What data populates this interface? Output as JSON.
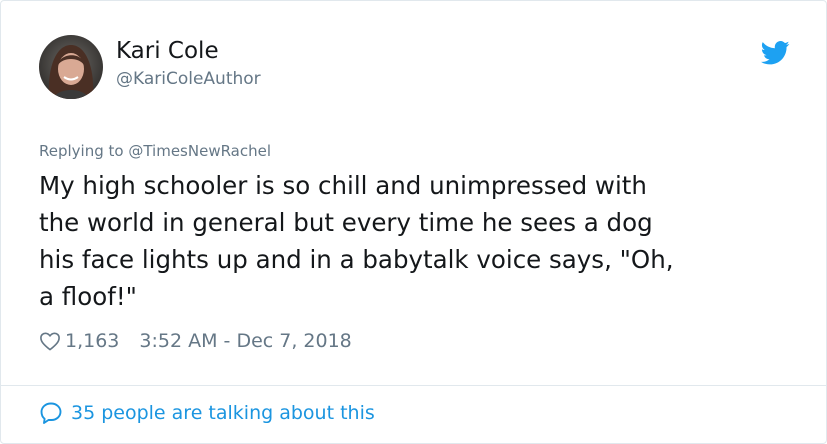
{
  "author": {
    "display_name": "Kari Cole",
    "handle": "@KariColeAuthor",
    "avatar_icon": "profile-photo"
  },
  "brand": {
    "icon": "twitter-bird-icon",
    "color": "#1da1f2"
  },
  "reply": {
    "prefix": "Replying to ",
    "mention": "@TimesNewRachel"
  },
  "tweet": {
    "text": "My high schooler is so chill and unimpressed with\nthe world in general but every time he sees a dog\nhis face lights up and in a babytalk voice says, \"Oh,\na floof!\""
  },
  "meta": {
    "like_icon": "heart-icon",
    "like_count": "1,163",
    "timestamp": "3:52 AM - Dec 7, 2018"
  },
  "conversation": {
    "icon": "speech-bubble-icon",
    "label": "35 people are talking about this",
    "color": "#1b95e0"
  }
}
